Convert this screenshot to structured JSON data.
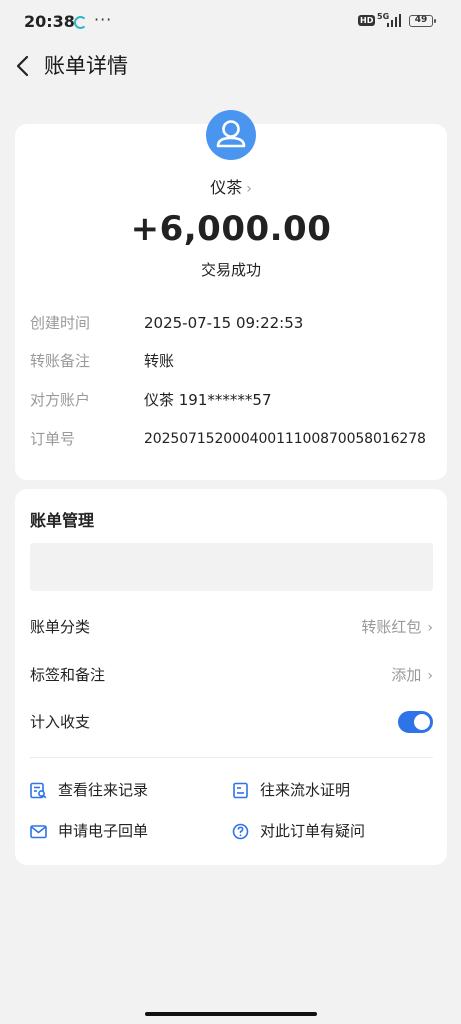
{
  "status_bar": {
    "time": "20:38",
    "dots": "···",
    "hd": "HD",
    "network": "5G",
    "battery": "49"
  },
  "header": {
    "title": "账单详情"
  },
  "transaction": {
    "merchant": "仪茶",
    "amount": "+6,000.00",
    "status": "交易成功",
    "details": [
      {
        "label": "创建时间",
        "value": "2025-07-15 09:22:53"
      },
      {
        "label": "转账备注",
        "value": "转账"
      },
      {
        "label": "对方账户",
        "value": "仪茶 191******57"
      },
      {
        "label": "订单号",
        "value": "20250715200040011100870058016278"
      }
    ]
  },
  "management": {
    "title": "账单管理",
    "category_label": "账单分类",
    "category_value": "转账红包",
    "tags_label": "标签和备注",
    "tags_value": "添加",
    "include_label": "计入收支",
    "include_on": true
  },
  "links": {
    "records": "查看往来记录",
    "flow_proof": "往来流水证明",
    "receipt": "申请电子回单",
    "question": "对此订单有疑问"
  },
  "colors": {
    "accent": "#2f73e8",
    "avatar": "#4a95f0",
    "background": "#f2f2f2"
  }
}
